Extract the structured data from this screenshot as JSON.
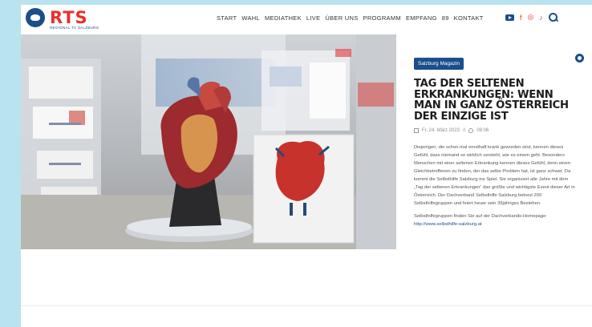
{
  "header": {
    "logo_text": "RTS",
    "logo_sub": "REGIONAL TV SALZBURG",
    "nav": [
      "START",
      "WAHL",
      "MEDIATHEK",
      "LIVE",
      "ÜBER UNS",
      "PROGRAMM",
      "EMPFANG",
      "89",
      "KONTAKT"
    ],
    "social_icons": [
      "youtube-icon",
      "facebook-icon",
      "instagram-icon",
      "tiktok-icon"
    ]
  },
  "article": {
    "category": "Salzburg Magazin",
    "title": "Tag der seltenen Erkrankungen: Wenn man in ganz Österreich der Einzige ist",
    "date": "Fr, 24. März 2023",
    "time": "08:06",
    "paragraph1": "Diejenigen, die schon mal ernsthaft krank geworden sind, kennen dieses Gefühl, dass niemand so wirklich versteht, wie es einem geht. Besonders Menschen mit einer seltenen Erkrankung kennen dieses Gefühl, denn einen Gleichbetroffenen zu finden, der das selbe Problem hat, ist ganz schwer. Da kommt die Selbsthilfe Salzburg ins Spiel. Sie organisiert alle Jahre mit dem „Tag der seltenen Erkrankungen“ das größte und wichtigste Event dieser Art in Österreich. Der Dachverband Selbsthilfe Salzburg betreut 200 Selbsthilfegruppen und feiert heuer sein 35jähriges Bestehen.",
    "paragraph2_prefix": "Selbsthilfegruppen finden Sie auf der Dachverbands-Homepage:",
    "paragraph2_link": "http://www.selbsthilfe-salzburg.at"
  },
  "colors": {
    "brand_blue": "#1b4e8c",
    "brand_red": "#e8312c",
    "background": "#b9e3ef"
  }
}
